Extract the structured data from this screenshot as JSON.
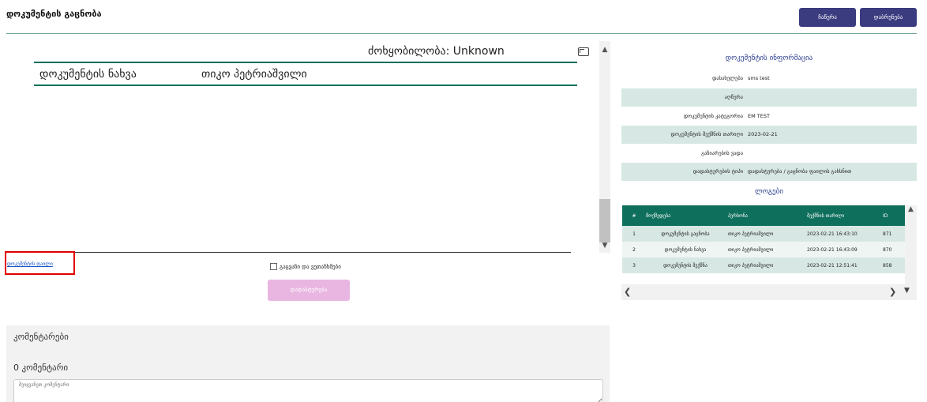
{
  "header": {
    "title": "დოკუმენტის გაცნობა",
    "sign_label": "ჩაწერა",
    "return_label": "დაბრუნება"
  },
  "viewer": {
    "status_text": "ძოხყობილობა: Unknown",
    "doc_label": "დოკუმენტის ნახვა",
    "doc_user": "თიკო პეტრიაშვილი"
  },
  "actions": {
    "doc_link": "დოკუმენტის ფაილი",
    "agree_label": "გაცვანი და ვეთანხმები",
    "confirm_label": "დადასტურება"
  },
  "comments": {
    "title": "კომენტარები",
    "count": "0 კომენტარი",
    "placeholder": "შეიყვანეთ კომენტარი"
  },
  "info": {
    "title": "დოკუმენტის ინფორმაცია",
    "rows": [
      {
        "label": "დასახელება",
        "value": "sms test"
      },
      {
        "label": "აღწერა",
        "value": ""
      },
      {
        "label": "დოკუმენტის კატეგორია",
        "value": "EM TEST"
      },
      {
        "label": "დოკუმენტის შექმნის თარიღი",
        "value": "2023-02-21"
      },
      {
        "label": "გაზიარების ვადა",
        "value": ""
      },
      {
        "label": "დადასტურების ტიპი",
        "value": "დადასტურება / გაცნობა ფაილის გახსნით"
      }
    ]
  },
  "logs": {
    "title": "ლოგები",
    "columns": [
      "#",
      "მოქმედება",
      "პერსონა",
      "შექმნის თარიღი",
      "ID"
    ],
    "rows": [
      {
        "num": "1",
        "action": "დოკუმენტის გაცნობა",
        "person": "თიკო პეტრიაშვილი",
        "date": "2023-02-21 16:43:10",
        "id": "871"
      },
      {
        "num": "2",
        "action": "დოკუმენტის ნახვა",
        "person": "თიკო პეტრიაშვილი",
        "date": "2023-02-21 16:43:09",
        "id": "870"
      },
      {
        "num": "3",
        "action": "დოკუმენტის შექმნა",
        "person": "თიკო პეტრიაშვილი",
        "date": "2023-02-21 12:51:41",
        "id": "858"
      }
    ]
  },
  "colors": {
    "primary_button": "#3b3b80",
    "accent_green": "#0e6f5c",
    "disabled_button": "#e8b6e1",
    "highlight_box": "#e00000"
  }
}
